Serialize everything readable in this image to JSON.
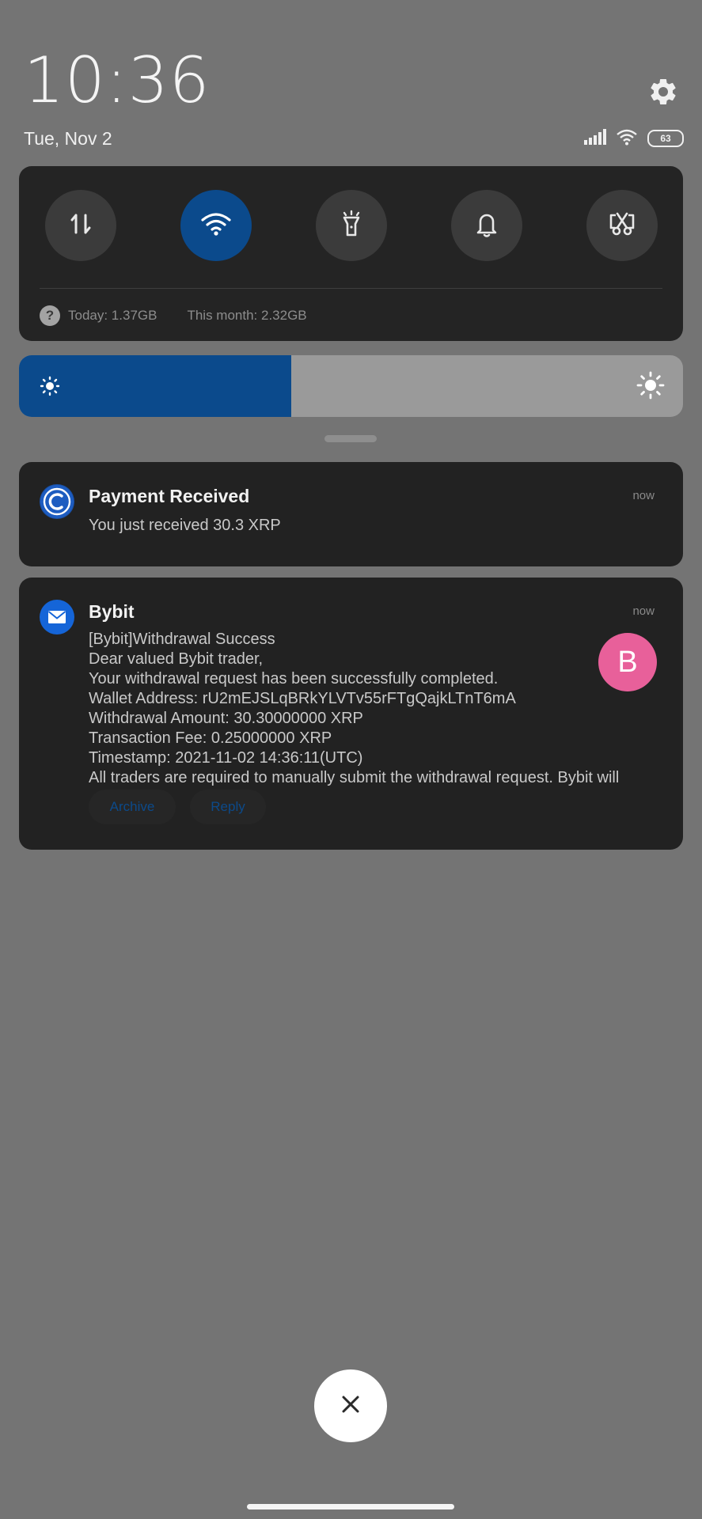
{
  "header": {
    "time": "10:36",
    "date": "Tue, Nov 2",
    "battery_level": "63"
  },
  "quick_settings": {
    "tiles": [
      {
        "name": "mobile-data",
        "icon": "data-arrows-icon",
        "active": false
      },
      {
        "name": "wifi",
        "icon": "wifi-icon",
        "active": true
      },
      {
        "name": "flashlight",
        "icon": "flashlight-icon",
        "active": false
      },
      {
        "name": "ringer",
        "icon": "bell-icon",
        "active": false
      },
      {
        "name": "screenshot",
        "icon": "scissors-screenshot-icon",
        "active": false
      }
    ],
    "usage_today": "Today: 1.37GB",
    "usage_month": "This month: 2.32GB"
  },
  "brightness": {
    "level": 0.41
  },
  "notifications": [
    {
      "app_icon": "coin-c-icon",
      "title": "Payment Received",
      "time": "now",
      "text": "You just received 30.3 XRP"
    },
    {
      "app_icon": "mail-icon",
      "title": "Bybit",
      "time": "now",
      "avatar_letter": "B",
      "lines": [
        "[Bybit]Withdrawal Success",
        "Dear valued Bybit trader,",
        "Your withdrawal request has been successfully completed.",
        "Wallet Address: rU2mEJSLqBRkYLVTv55rFTgQajkLTnT6mA",
        "Withdrawal Amount: 30.30000000 XRP",
        "Transaction Fee: 0.25000000 XRP",
        "Timestamp: 2021-11-02 14:36:11(UTC)",
        "All traders are required to manually submit the withdrawal request. Bybit will"
      ],
      "actions": [
        "Archive",
        "Reply"
      ]
    }
  ],
  "colors": {
    "background": "#747474",
    "panel": "#242424",
    "accent": "#0b4a8c",
    "avatar": "#e8609a"
  }
}
